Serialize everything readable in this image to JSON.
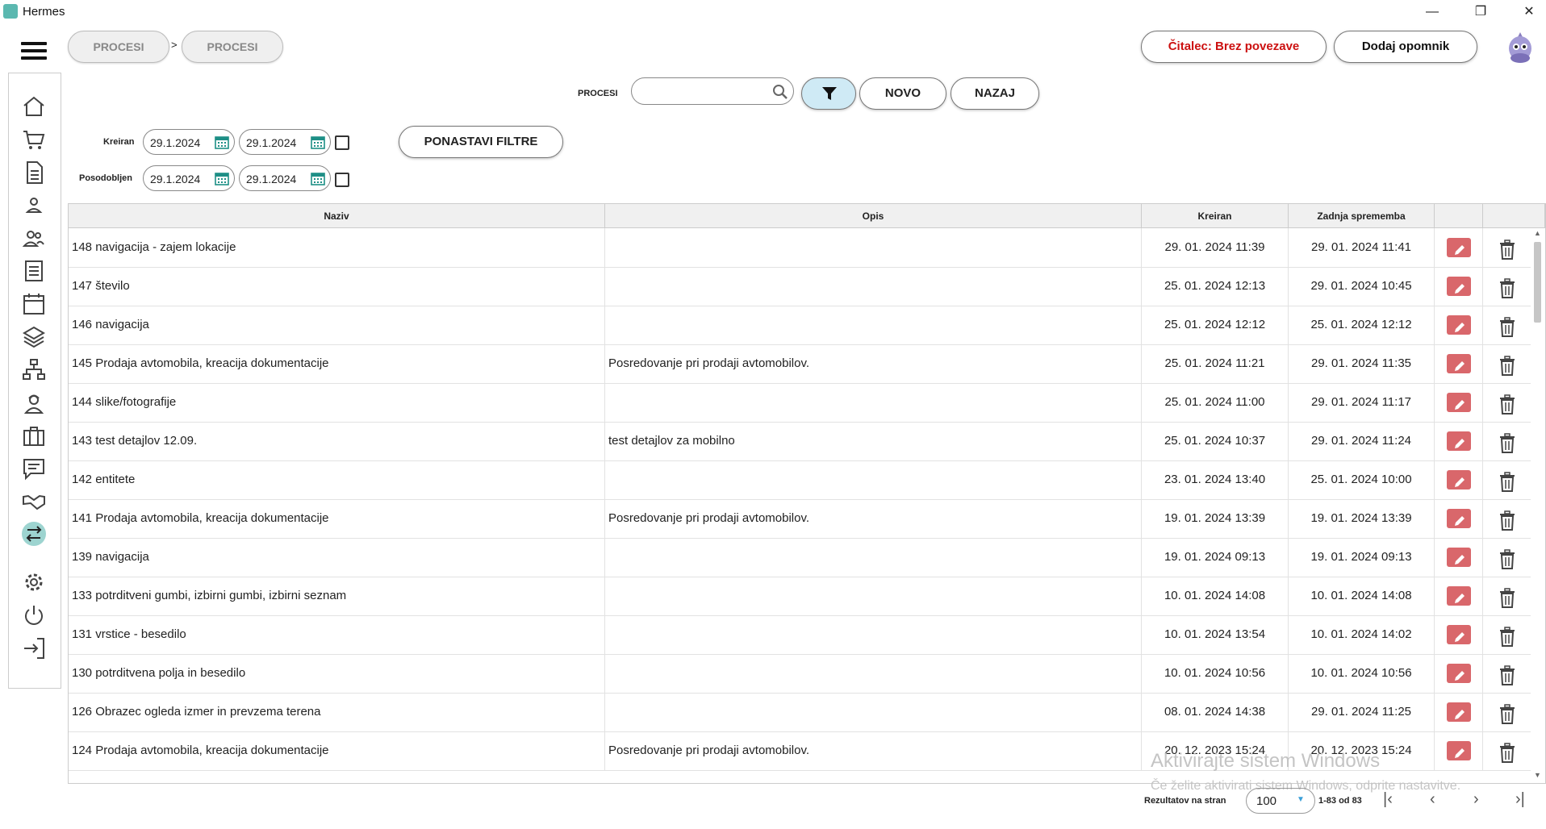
{
  "window": {
    "title": "Hermes"
  },
  "breadcrumb": [
    "PROCESI",
    "PROCESI"
  ],
  "breadcrumb_separator": ">",
  "header": {
    "reader_status": "Čitalec: Brez povezave",
    "reminder_button": "Dodaj opomnik"
  },
  "search": {
    "label": "PROCESI",
    "value": ""
  },
  "toolbar": {
    "new_label": "NOVO",
    "back_label": "NAZAJ",
    "reset_filters_label": "PONASTAVI FILTRE"
  },
  "filters": {
    "created_label": "Kreiran",
    "created_from": "29.1.2024",
    "created_to": "29.1.2024",
    "updated_label": "Posodobljen",
    "updated_from": "29.1.2024",
    "updated_to": "29.1.2024"
  },
  "table": {
    "headers": {
      "name": "Naziv",
      "desc": "Opis",
      "created": "Kreiran",
      "modified": "Zadnja sprememba"
    },
    "rows": [
      {
        "name": "148 navigacija - zajem lokacije",
        "desc": "",
        "created": "29. 01. 2024 11:39",
        "modified": "29. 01. 2024 11:41"
      },
      {
        "name": "147 število",
        "desc": "",
        "created": "25. 01. 2024 12:13",
        "modified": "29. 01. 2024 10:45"
      },
      {
        "name": "146 navigacija",
        "desc": "",
        "created": "25. 01. 2024 12:12",
        "modified": "25. 01. 2024 12:12"
      },
      {
        "name": "145 Prodaja avtomobila, kreacija dokumentacije",
        "desc": "Posredovanje pri prodaji avtomobilov.",
        "created": "25. 01. 2024 11:21",
        "modified": "29. 01. 2024 11:35"
      },
      {
        "name": "144 slike/fotografije",
        "desc": "",
        "created": "25. 01. 2024 11:00",
        "modified": "29. 01. 2024 11:17"
      },
      {
        "name": "143 test detajlov 12.09.",
        "desc": "test detajlov za mobilno",
        "created": "25. 01. 2024 10:37",
        "modified": "29. 01. 2024 11:24"
      },
      {
        "name": "142 entitete",
        "desc": "",
        "created": "23. 01. 2024 13:40",
        "modified": "25. 01. 2024 10:00"
      },
      {
        "name": "141 Prodaja avtomobila, kreacija dokumentacije",
        "desc": "Posredovanje pri prodaji avtomobilov.",
        "created": "19. 01. 2024 13:39",
        "modified": "19. 01. 2024 13:39"
      },
      {
        "name": "139 navigacija",
        "desc": "",
        "created": "19. 01. 2024 09:13",
        "modified": "19. 01. 2024 09:13"
      },
      {
        "name": "133 potrditveni gumbi, izbirni gumbi, izbirni seznam",
        "desc": "",
        "created": "10. 01. 2024 14:08",
        "modified": "10. 01. 2024 14:08"
      },
      {
        "name": "131 vrstice - besedilo",
        "desc": "",
        "created": "10. 01. 2024 13:54",
        "modified": "10. 01. 2024 14:02"
      },
      {
        "name": "130 potrditvena polja in besedilo",
        "desc": "",
        "created": "10. 01. 2024 10:56",
        "modified": "10. 01. 2024 10:56"
      },
      {
        "name": "126 Obrazec ogleda izmer in prevzema terena",
        "desc": "",
        "created": "08. 01. 2024 14:38",
        "modified": "29. 01. 2024 11:25"
      },
      {
        "name": "124 Prodaja avtomobila, kreacija dokumentacije",
        "desc": "Posredovanje pri prodaji avtomobilov.",
        "created": "20. 12. 2023 15:24",
        "modified": "20. 12. 2023 15:24"
      }
    ]
  },
  "pagination": {
    "per_page_label": "Rezultatov na stran",
    "per_page_value": "100",
    "range_text": "1-83 od 83"
  },
  "watermark": {
    "line1": "Aktivirajte sistem Windows",
    "line2": "Če želite aktivirati sistem Windows, odprite nastavitve."
  },
  "sidebar_icons": [
    "home-icon",
    "cart-icon",
    "document-icon",
    "person-icon",
    "people-icon",
    "list-icon",
    "calendar-icon",
    "layers-icon",
    "org-chart-icon",
    "worker-icon",
    "briefcase-icon",
    "chat-icon",
    "handshake-icon",
    "process-icon",
    "gear-icon",
    "power-icon",
    "logout-icon"
  ],
  "colors": {
    "accent_teal": "#5bb8b0",
    "filter_active": "#cfeaf5",
    "edit_button": "#d9676b",
    "reader_status_red": "#cc1010",
    "calendar_teal": "#1e8f86"
  }
}
